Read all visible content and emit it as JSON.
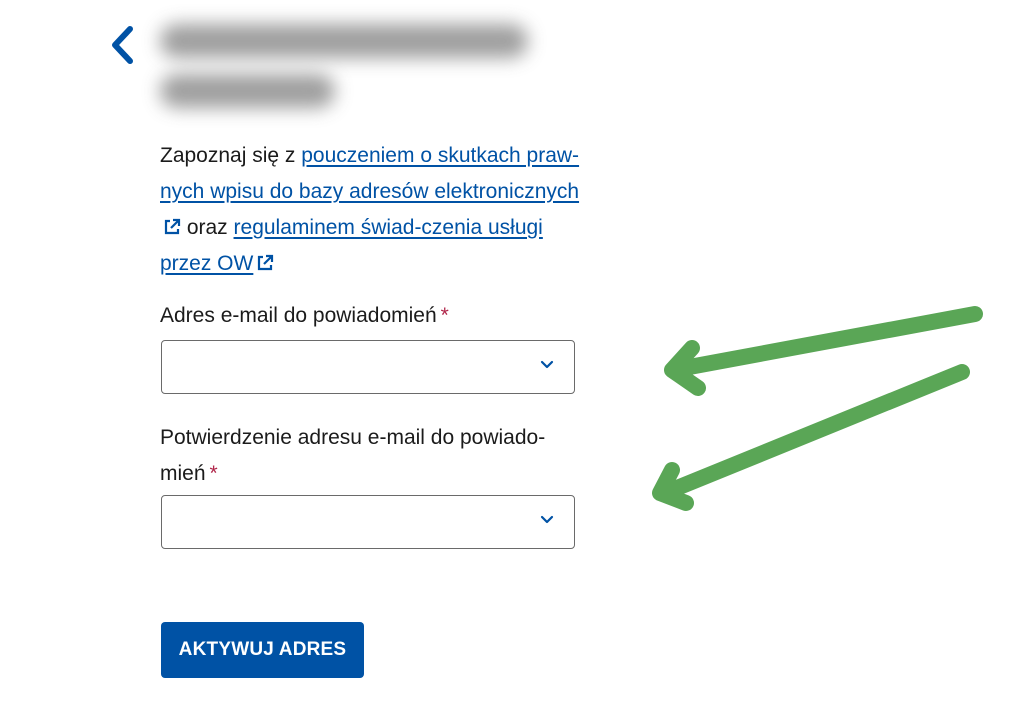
{
  "header": {
    "back_icon": "chevron-left-icon"
  },
  "consent": {
    "prefix": "Zapoznaj się z ",
    "link1_text": "pouczeniem o skutkach praw-nych wpisu do bazy adresów elektronicznych",
    "middle": " oraz ",
    "link2_text": "regulaminem świad-czenia usługi przez OW",
    "link_icon": "external-link-icon"
  },
  "form": {
    "email_label": "Adres e-mail do powiadomień",
    "confirm_label": "Potwierdzenie adresu e-mail do powiado-mień",
    "required_mark": "*",
    "select_icon": "chevron-down-icon"
  },
  "actions": {
    "submit_label": "AKTYWUJ ADRES"
  },
  "colors": {
    "link": "#0052a5",
    "primary_button": "#0052a5",
    "required": "#b0264a",
    "annotation_arrow": "#5aa656"
  }
}
